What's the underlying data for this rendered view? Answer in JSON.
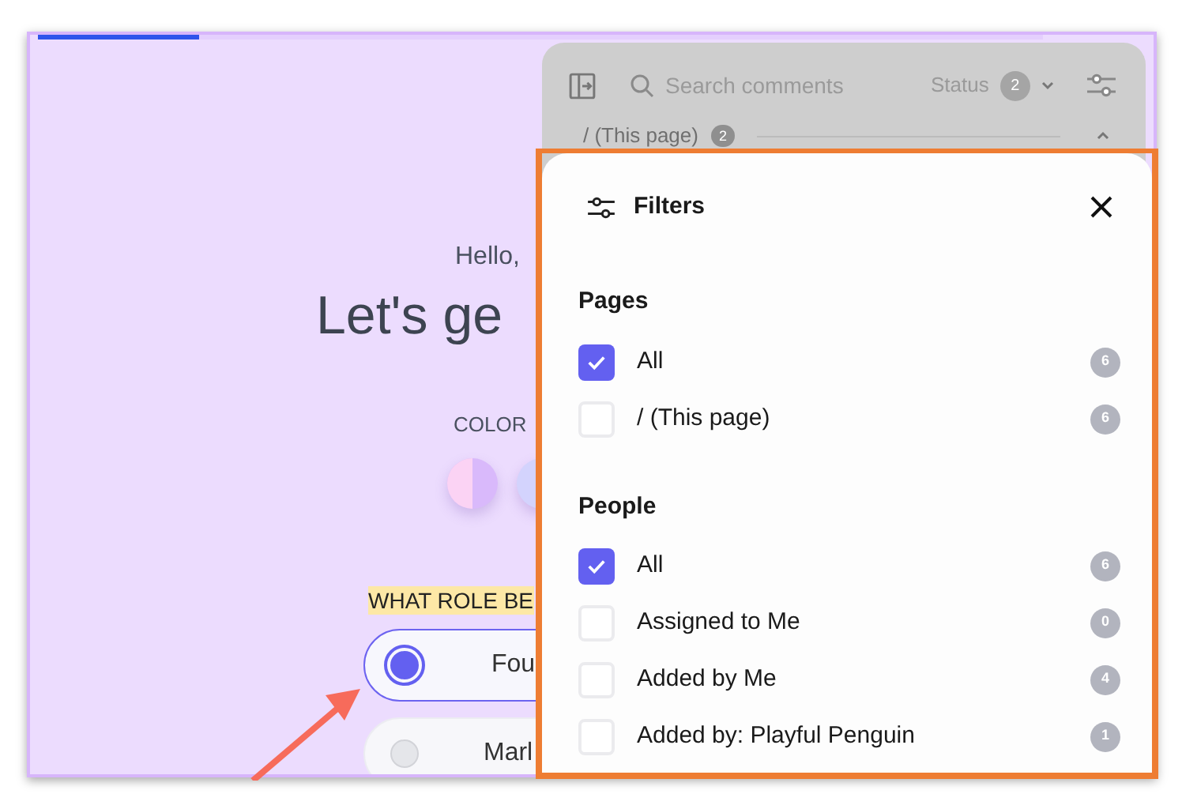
{
  "progress": {
    "level": 0.16
  },
  "page": {
    "greeting": "Hello,",
    "heading": "Let's ge",
    "color_label": "COLOR",
    "swatches": [
      {
        "kind": "split",
        "color": "#d9b9fb"
      },
      {
        "kind": "solid",
        "color": "#d3d3fd"
      }
    ],
    "role_question": "WHAT ROLE BE",
    "roles": [
      {
        "label": "Fou",
        "selected": true
      },
      {
        "label": "Marl",
        "selected": false
      }
    ]
  },
  "comments": {
    "search": {
      "placeholder": "Search comments"
    },
    "status": {
      "label": "Status",
      "count": "2"
    },
    "group": {
      "label": "/ (This page)",
      "count": "2",
      "expanded": true
    }
  },
  "filters": {
    "title": "Filters",
    "sections": [
      {
        "title": "Pages",
        "items": [
          {
            "label": "All",
            "checked": true,
            "count": "6"
          },
          {
            "label": "/ (This page)",
            "checked": false,
            "count": "6"
          }
        ]
      },
      {
        "title": "People",
        "items": [
          {
            "label": "All",
            "checked": true,
            "count": "6"
          },
          {
            "label": "Assigned to Me",
            "checked": false,
            "count": "0"
          },
          {
            "label": "Added by Me",
            "checked": false,
            "count": "4"
          },
          {
            "label": "Added by: Playful Penguin",
            "checked": false,
            "count": "1"
          }
        ]
      }
    ]
  }
}
